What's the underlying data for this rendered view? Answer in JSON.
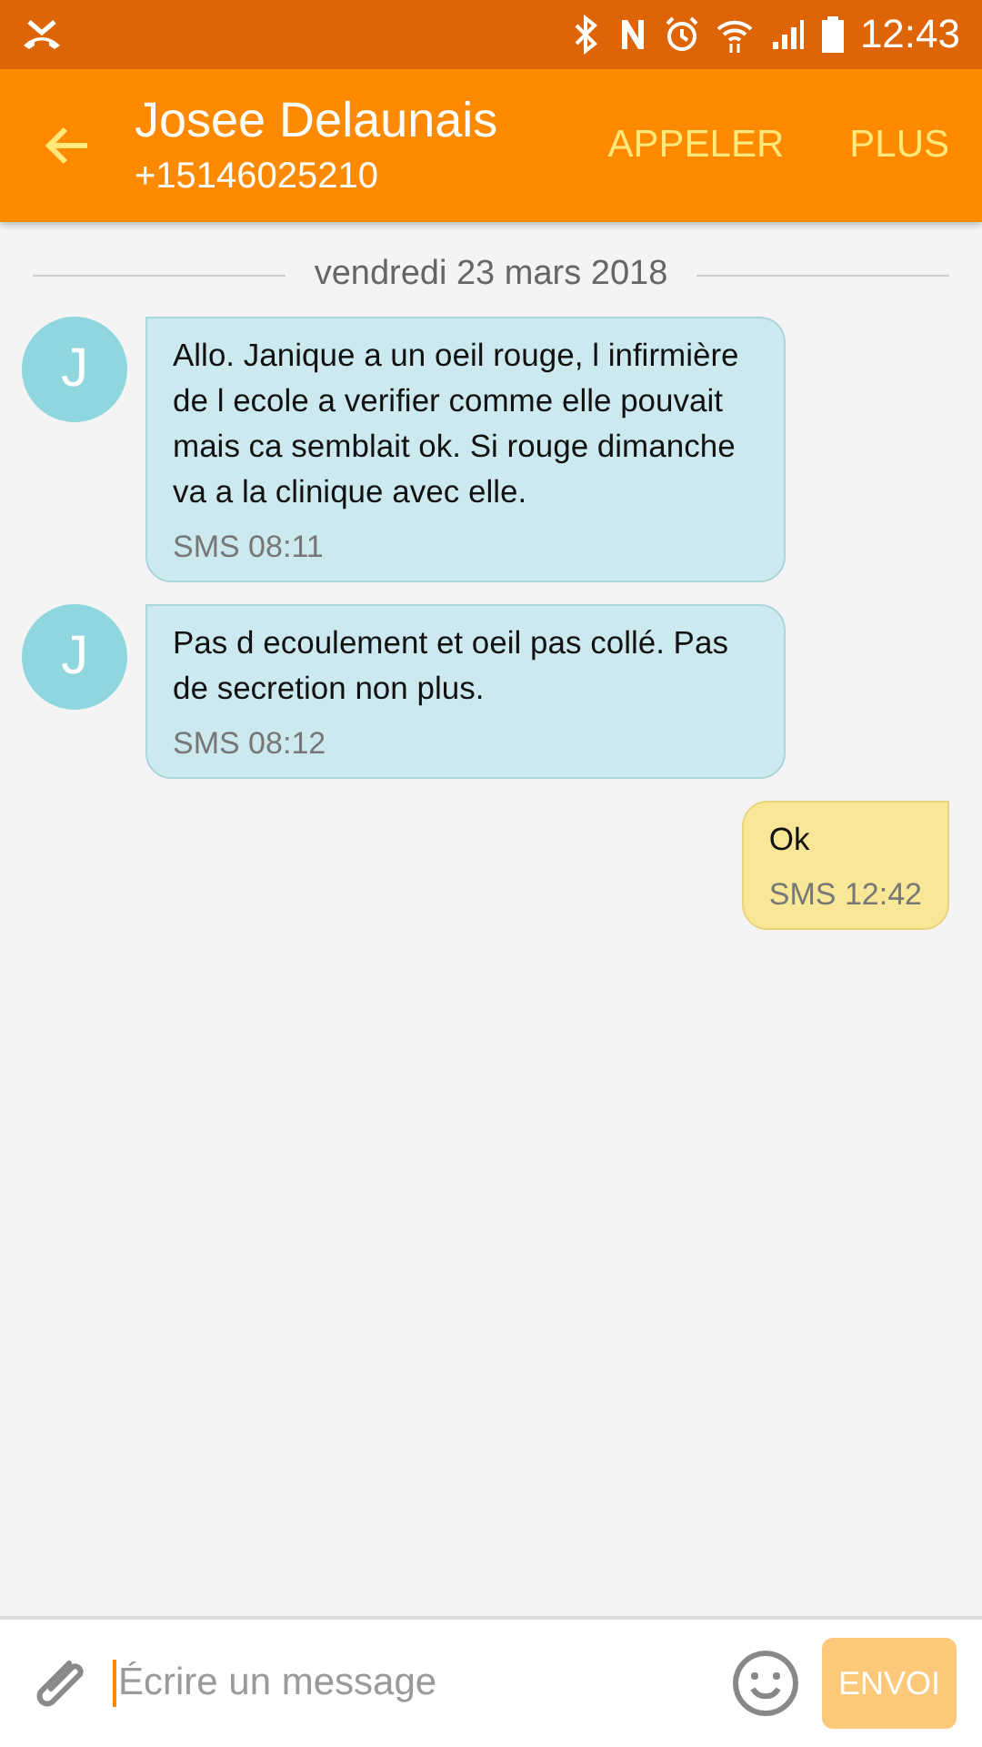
{
  "status_bar": {
    "time": "12:43"
  },
  "app_bar": {
    "contact_name": "Josee Delaunais",
    "phone": "+15146025210",
    "actions": [
      "APPELER",
      "PLUS"
    ]
  },
  "date_divider": "vendredi 23 mars 2018",
  "messages": [
    {
      "kind": "incoming",
      "avatar": "J",
      "text": "Allo. Janique a un oeil rouge, l infirmière de l ecole a verifier comme elle pouvait mais ca semblait ok. Si rouge dimanche va a la clinique avec elle.",
      "meta": "SMS 08:11"
    },
    {
      "kind": "incoming",
      "avatar": "J",
      "text": "Pas d ecoulement et oeil pas collé. Pas de secretion non plus.",
      "meta": "SMS 08:12"
    },
    {
      "kind": "outgoing",
      "text": "Ok",
      "meta": "SMS 12:42"
    }
  ],
  "composer": {
    "placeholder": "Écrire un message",
    "send_label": "ENVOI",
    "send_disabled": true
  }
}
